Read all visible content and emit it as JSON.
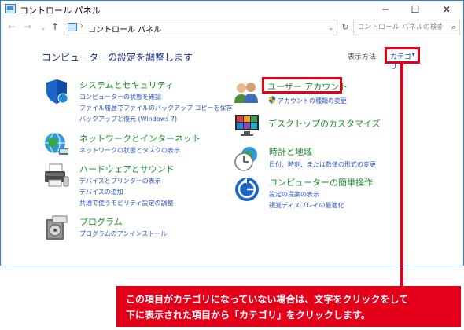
{
  "window": {
    "title": "コントロール パネル",
    "minimize": "─",
    "maximize": "☐",
    "close": "✕"
  },
  "address": {
    "back": "←",
    "forward": "→",
    "recent": "⌄",
    "up": "↑",
    "separator": "›",
    "crumb": "コントロール パネル",
    "dropdown": "⌄",
    "refresh": "↻",
    "search_placeholder": "コントロール パネルの検索",
    "search_icon": "⌕"
  },
  "main": {
    "heading": "コンピューターの設定を調整します",
    "view_by_label": "表示方法:",
    "view_by_value": "カテゴリ",
    "view_by_arrow": "▼"
  },
  "categories": [
    {
      "id": "system-security",
      "icon": "shield-icon",
      "title": "システムとセキュリティ",
      "links": [
        "コンピューターの状態を確認",
        "ファイル履歴でファイルのバックアップ コピーを保存",
        "バックアップと復元 (Windows 7)"
      ]
    },
    {
      "id": "network-internet",
      "icon": "globe-network-icon",
      "title": "ネットワークとインターネット",
      "links": [
        "ネットワークの状態とタスクの表示"
      ]
    },
    {
      "id": "hardware-sound",
      "icon": "printer-icon",
      "title": "ハードウェアとサウンド",
      "links": [
        "デバイスとプリンターの表示",
        "デバイスの追加",
        "共通で使うモビリティ設定の調整"
      ]
    },
    {
      "id": "programs",
      "icon": "programs-icon",
      "title": "プログラム",
      "links": [
        "プログラムのアンインストール"
      ]
    },
    {
      "id": "user-accounts",
      "icon": "users-icon",
      "title": "ユーザー アカウント",
      "links": [
        "アカウントの種類の変更"
      ]
    },
    {
      "id": "desktop-customization",
      "icon": "display-icon",
      "title": "デスクトップのカスタマイズ",
      "links": []
    },
    {
      "id": "clock-region",
      "icon": "clock-globe-icon",
      "title": "時計と地域",
      "links": [
        "日付、時刻、または数値の形式の変更"
      ]
    },
    {
      "id": "ease-of-access",
      "icon": "ease-of-access-icon",
      "title": "コンピューターの簡単操作",
      "links": [
        "設定の提案の表示",
        "視覚ディスプレイの最適化"
      ]
    }
  ],
  "callout": {
    "line1": "この項目がカテゴリになっていない場合は、文字をクリックをして",
    "line2": "下に表示された項目から「カテゴリ」をクリックします。"
  },
  "colors": {
    "accent_red": "#e4001b",
    "category_green": "#1e8f2f",
    "link_blue": "#2a53c2",
    "heading_navy": "#1e3287"
  }
}
